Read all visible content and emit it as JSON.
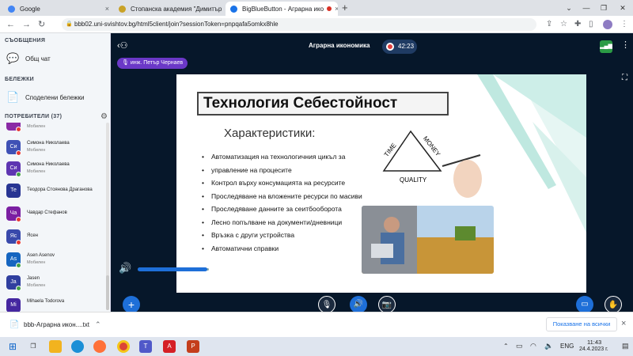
{
  "browser": {
    "tabs": [
      {
        "title": "Google",
        "close": "×"
      },
      {
        "title": "Стопанска академия \"Димитър",
        "close": "×"
      },
      {
        "title": "BigBlueButton - Аграрна ико",
        "close": "×"
      }
    ],
    "new_tab": "+",
    "url": "bbb02.uni-svishtov.bg/html5client/join?sessionToken=pnpqafa5omkx8hle"
  },
  "sidebar": {
    "messages_title": "СЪОБЩЕНИЯ",
    "public_chat": "Общ чат",
    "notes_title": "БЕЛЕЖКИ",
    "shared_notes": "Споделени бележки",
    "users_title": "ПОТРЕБИТЕЛИ (37)",
    "users": [
      {
        "initials": "",
        "name": "",
        "status": "Мобилен",
        "color": "#8a2aa5"
      },
      {
        "initials": "Си",
        "name": "Симона Николаева",
        "status": "Мобилен",
        "color": "#3f51b5"
      },
      {
        "initials": "Си",
        "name": "Симона Николаева",
        "status": "Мобилен",
        "color": "#5e35b1"
      },
      {
        "initials": "Те",
        "name": "Теодора Стоянова Драганова",
        "status": "",
        "color": "#283593"
      },
      {
        "initials": "Ча",
        "name": "Чавдар Стефанов",
        "status": "",
        "color": "#7b1fa2"
      },
      {
        "initials": "Яс",
        "name": "Ясен",
        "status": "",
        "color": "#3949ab"
      },
      {
        "initials": "As",
        "name": "Asen Asenov",
        "status": "Мобилен",
        "color": "#1565c0"
      },
      {
        "initials": "Ja",
        "name": "Jasen",
        "status": "Мобилен",
        "color": "#303f9f"
      },
      {
        "initials": "Mi",
        "name": "Mihaela Todorova",
        "status": "",
        "color": "#4527a0"
      }
    ]
  },
  "meeting": {
    "title": "Аграрна икономика",
    "timer": "42:23",
    "presenter": "инж. Петър Чернаев"
  },
  "slide": {
    "title": "Технология Себестойност",
    "subtitle": "Характеристики:",
    "bullets": [
      "Автоматизация на технологичния цикъл за",
      "управление на процесите",
      "Контрол върху консумацията на ресурсите",
      "Проследяване на вложените ресурси по масиви",
      "Проследяване данните за сеитбооборота",
      "Лесно попълване на документи/дневници",
      "Връзка с други устройства",
      "Автоматични справки"
    ],
    "diagram": {
      "left": "TIME",
      "right": "MONEY",
      "bottom": "QUALITY"
    }
  },
  "download": {
    "file": "bbb-Аграрна икон....txt",
    "show_all": "Показване на всички",
    "close": "×"
  },
  "taskbar": {
    "lang": "ENG",
    "time": "11:43",
    "date": "24.4.2023 г."
  }
}
